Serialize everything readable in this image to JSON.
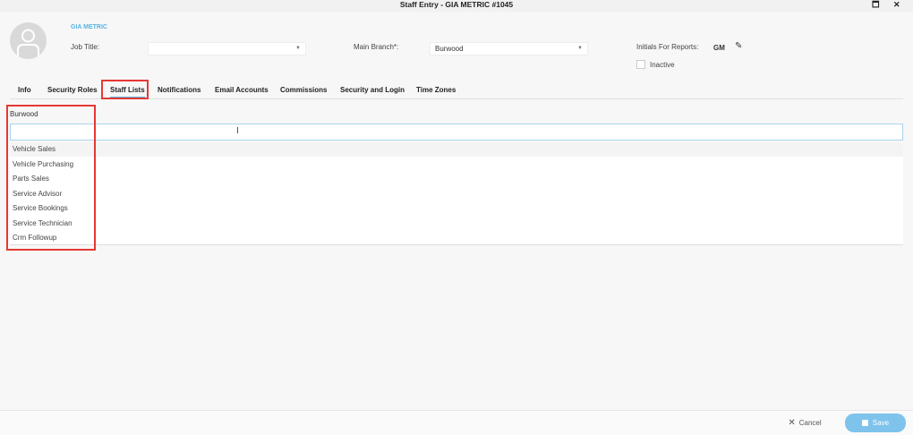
{
  "window": {
    "title": "Staff Entry - GIA METRIC #1045"
  },
  "staff": {
    "name": "GIA METRIC",
    "job_title_label": "Job Title:",
    "job_title_value": "",
    "main_branch_label": "Main Branch*:",
    "main_branch_value": "Burwood",
    "initials_label": "Initials For Reports:",
    "initials_value": "GM",
    "inactive_label": "Inactive"
  },
  "tabs": [
    "Info",
    "Security Roles",
    "Staff Lists",
    "Notifications",
    "Email Accounts",
    "Commissions",
    "Security and Login",
    "Time Zones"
  ],
  "active_tab": "Staff Lists",
  "staff_lists": {
    "branch": "Burwood",
    "search_value": "",
    "items": [
      "Vehicle Sales",
      "Vehicle Purchasing",
      "Parts Sales",
      "Service Advisor",
      "Service Bookings",
      "Service Technician",
      "Crm Followup"
    ]
  },
  "footer": {
    "cancel_label": "Cancel",
    "save_label": "Save"
  }
}
